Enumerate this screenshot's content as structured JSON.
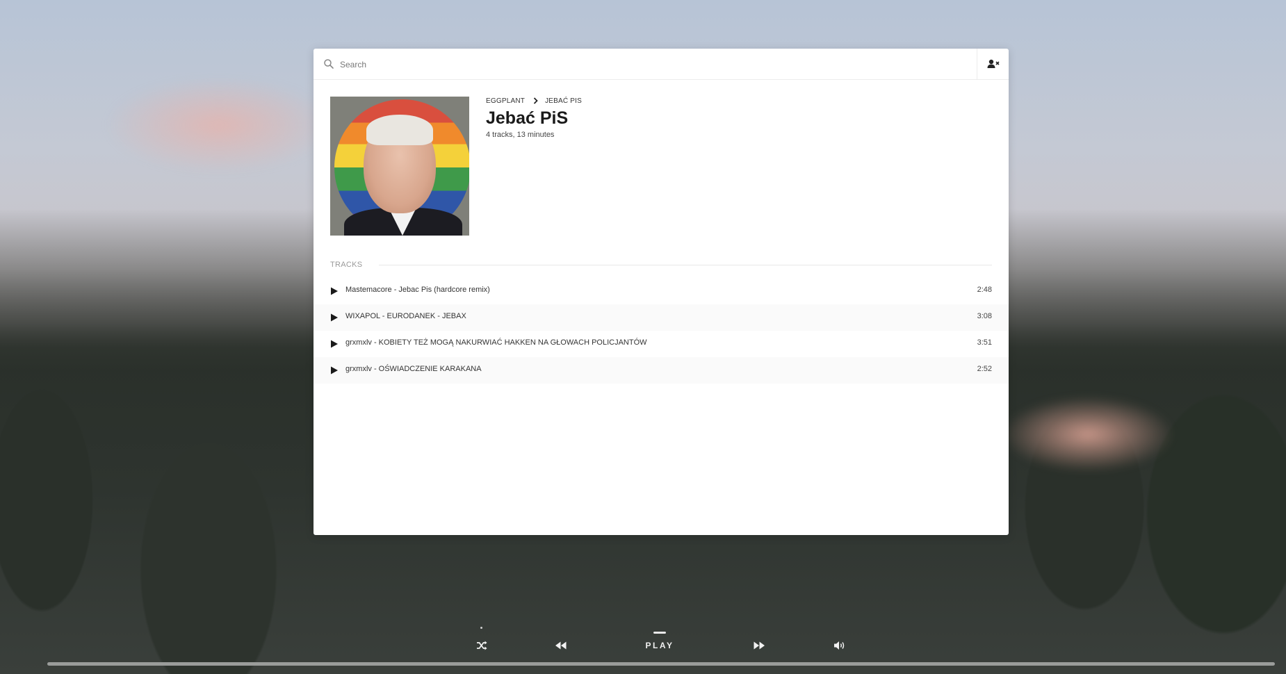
{
  "search": {
    "placeholder": "Search"
  },
  "breadcrumb": {
    "parent": "EGGPLANT",
    "current": "JEBAĆ PIS"
  },
  "album": {
    "title": "Jebać PiS",
    "meta": "4 tracks, 13 minutes"
  },
  "tracks_section": {
    "label": "TRACKS"
  },
  "tracks": [
    {
      "title": "Mastemacore - Jebac Pis (hardcore remix)",
      "duration": "2:48"
    },
    {
      "title": "WIXAPOL - EURODANEK - JEBAX",
      "duration": "3:08"
    },
    {
      "title": "grxmxlv - KOBIETY TEŻ MOGĄ NAKURWIAĆ HAKKEN NA GŁOWACH POLICJANTÓW",
      "duration": "3:51"
    },
    {
      "title": "grxmxlv - OŚWIADCZENIE KARAKANA",
      "duration": "2:52"
    }
  ],
  "player": {
    "play_label": "PLAY",
    "progress_fraction": 0.0
  },
  "icons": {
    "search": "search-icon",
    "user": "user-remove-icon",
    "play": "play-icon",
    "shuffle": "shuffle-icon",
    "rewind": "rewind-icon",
    "fast_forward": "fast-forward-icon",
    "volume": "volume-icon",
    "chevron": "chevron-right-icon"
  },
  "colors": {
    "panel": "#ffffff",
    "text": "#1a1a1a",
    "muted": "#999999"
  }
}
